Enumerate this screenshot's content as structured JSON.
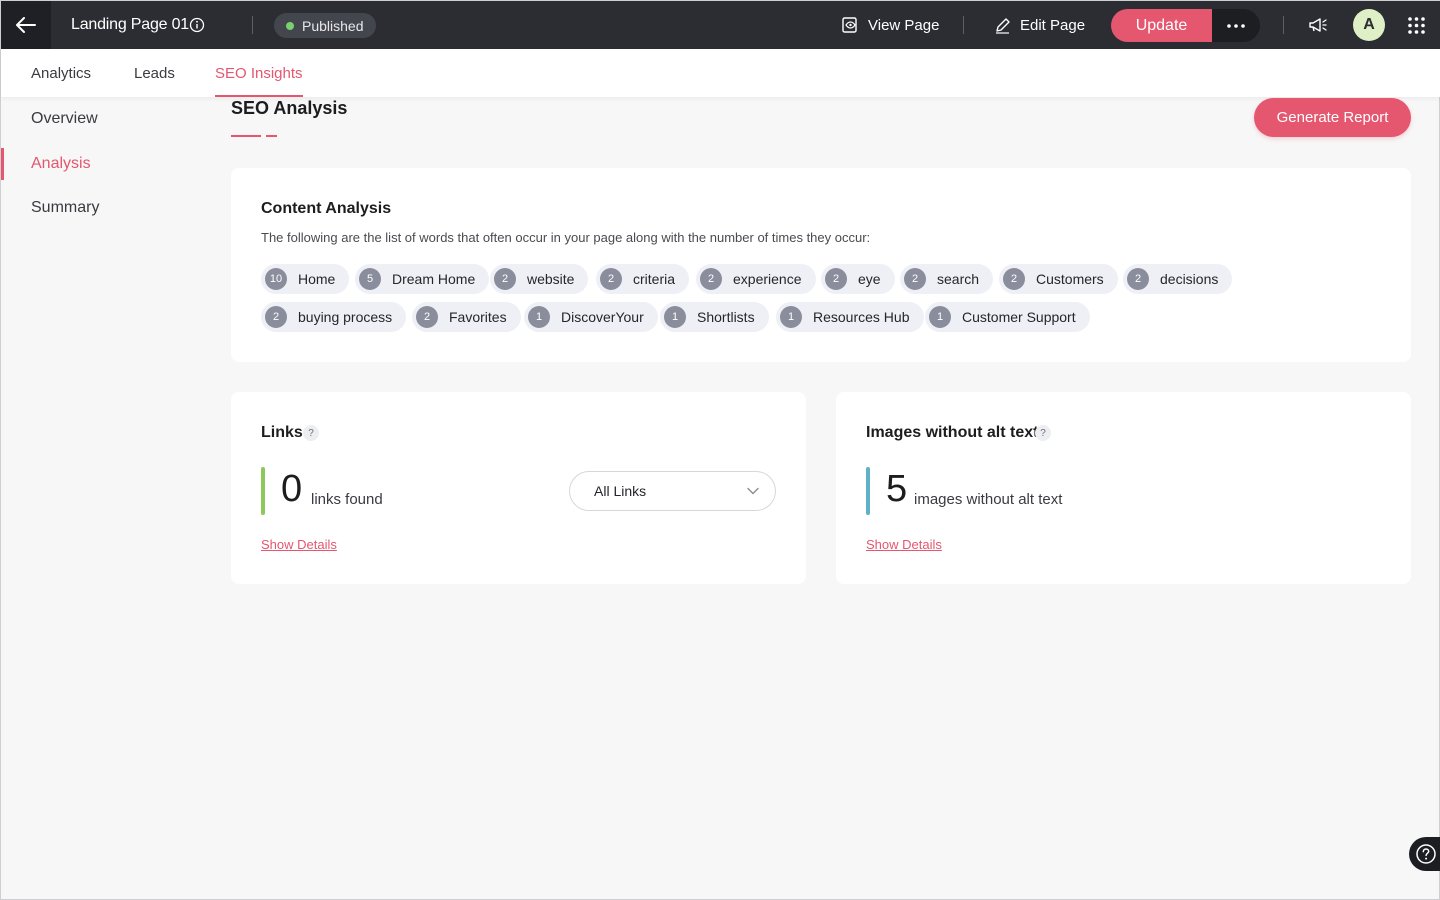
{
  "topbar": {
    "page_name": "Landing Page 01",
    "status": "Published",
    "view_page": "View Page",
    "edit_page": "Edit Page",
    "update": "Update",
    "avatar_initial": "A"
  },
  "tabs": [
    "Analytics",
    "Leads",
    "SEO Insights"
  ],
  "active_tab": "SEO Insights",
  "sidebar": {
    "items": [
      "Overview",
      "Analysis",
      "Summary"
    ],
    "active": "Analysis"
  },
  "main": {
    "title": "SEO Analysis",
    "generate_report": "Generate Report"
  },
  "content_analysis": {
    "title": "Content Analysis",
    "description": "The following are the list of words that often occur in your page along with the number of times they occur:",
    "keywords": [
      {
        "count": "10",
        "word": "Home"
      },
      {
        "count": "5",
        "word": "Dream Home"
      },
      {
        "count": "2",
        "word": "website"
      },
      {
        "count": "2",
        "word": "criteria"
      },
      {
        "count": "2",
        "word": "experience"
      },
      {
        "count": "2",
        "word": "eye"
      },
      {
        "count": "2",
        "word": "search"
      },
      {
        "count": "2",
        "word": "Customers"
      },
      {
        "count": "2",
        "word": "decisions"
      },
      {
        "count": "2",
        "word": "buying process"
      },
      {
        "count": "2",
        "word": "Favorites"
      },
      {
        "count": "1",
        "word": "DiscoverYour"
      },
      {
        "count": "1",
        "word": "Shortlists"
      },
      {
        "count": "1",
        "word": "Resources Hub"
      },
      {
        "count": "1",
        "word": "Customer Support"
      }
    ]
  },
  "links": {
    "title": "Links",
    "help": "?",
    "count": "0",
    "label": "links found",
    "filter_selected": "All Links",
    "show_details": "Show Details"
  },
  "images": {
    "title": "Images without alt text",
    "help": "?",
    "count": "5",
    "label": "images without alt text",
    "show_details": "Show Details"
  },
  "colors": {
    "accent": "#e5566f",
    "links_bar": "#8cc95a",
    "images_bar": "#5fb0c9",
    "topbar": "#2b2d33"
  }
}
